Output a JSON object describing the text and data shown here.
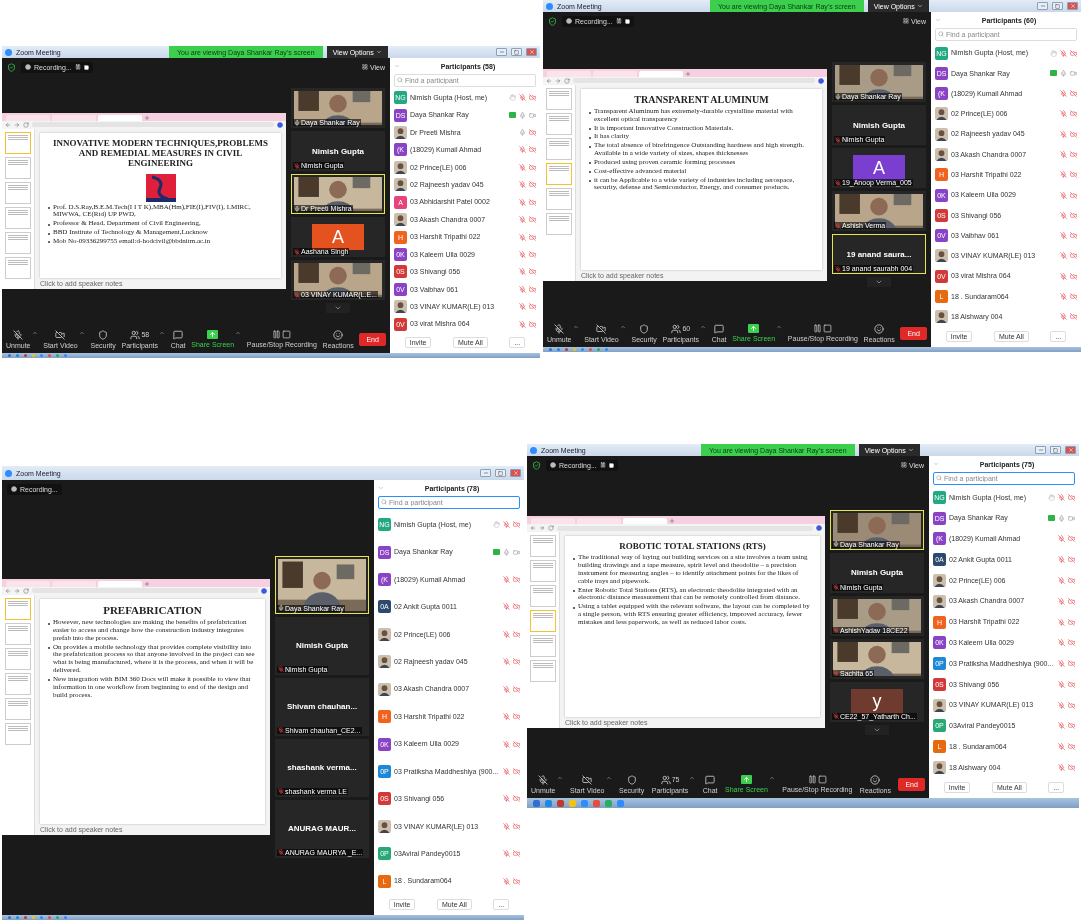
{
  "screenshots": [
    {
      "title": "Zoom Meeting",
      "banner": "You are viewing Daya Shankar Ray's screen",
      "view_options": "View Options",
      "secure": true,
      "recording": "Recording...",
      "recording_controls": true,
      "view": "View",
      "taskbar": true,
      "browser_tabs": [
        {
          "selected": false
        },
        {
          "selected": false
        },
        {
          "selected": true
        }
      ],
      "slide": {
        "title": "INNOVATIVE MODERN TECHNIQUES,PROBLEMS AND REMEDIAL MEASURES IN CIVIL ENGINEERING",
        "has_logo": true,
        "bullets": [
          "Prof. D.S.Ray,B.E.M.Tech(I I T K),MBA(Hm),FIE(I),FIV(I), LMIRC, MIWWA, CE(Rtd) UP PWD,",
          "Professor & Head, Department of Civil Engineering,",
          "BBD Institute of Technology & Management,Lucknow",
          "Mob No-09336299755    email:d-hodcivil@bbdnitm.ac.in"
        ],
        "notes": "Click to add speaker notes",
        "thumbnails": [
          {
            "selected": true
          },
          {
            "selected": false
          },
          {
            "selected": false
          },
          {
            "selected": false
          },
          {
            "selected": false
          },
          {
            "selected": false
          }
        ]
      },
      "videos": [
        {
          "kind": "video",
          "label": "Daya Shankar Ray",
          "mic_muted": false,
          "selected": false
        },
        {
          "kind": "name",
          "name": "Nimish Gupta",
          "label": "Nimish Gupta",
          "mic_muted": true,
          "selected": false
        },
        {
          "kind": "video",
          "label": "Dr Preeti Mishra",
          "mic_muted": false,
          "selected": true
        },
        {
          "kind": "avatar",
          "letter": "A",
          "color": "#e4531f",
          "label": "Aashana Singh",
          "mic_muted": true,
          "selected": false
        },
        {
          "kind": "video",
          "label": "03 VINAY KUMAR(L.E...",
          "mic_muted": true,
          "selected": false
        }
      ],
      "more_videos": true,
      "toolbar": [
        {
          "kind": "mic",
          "label": "Unmute",
          "menu": true
        },
        {
          "kind": "video",
          "label": "Start Video",
          "menu": true
        },
        {
          "kind": "security",
          "label": "Security",
          "menu": false
        },
        {
          "kind": "participants",
          "label": "Participants",
          "count": "58",
          "menu": true
        },
        {
          "kind": "chat",
          "label": "Chat",
          "menu": false
        },
        {
          "kind": "share",
          "label": "Share Screen",
          "menu": true
        },
        {
          "kind": "record",
          "label": "Pause/Stop Recording",
          "menu": false
        },
        {
          "kind": "reactions",
          "label": "Reactions",
          "menu": false
        }
      ],
      "end_button": "End",
      "participants": {
        "title": "Participants (58)",
        "search": {
          "placeholder": "Find a participant",
          "focused": false
        },
        "footer": [
          "Invite",
          "Mute All",
          "..."
        ],
        "rows": [
          {
            "kind": "initials",
            "initials": "NG",
            "color": "#22a882",
            "name": "Nimish Gupta (Host, me)",
            "host": true,
            "sharing": false,
            "mic_muted": true,
            "video_off": true
          },
          {
            "kind": "initials",
            "initials": "DS",
            "color": "#8a43c4",
            "name": "Daya Shankar Ray",
            "host": false,
            "sharing": true,
            "mic_muted": false,
            "video_off": false
          },
          {
            "name": "Dr Preeti Mishra",
            "host": false,
            "sharing": false,
            "mic_muted": false,
            "video_off": true
          },
          {
            "kind": "initials",
            "initials": "(K",
            "color": "#8a43c4",
            "name": "(18029) Kumail Ahmad",
            "host": false,
            "sharing": false,
            "mic_muted": true,
            "video_off": true
          },
          {
            "name": "02 Prince(LE) 006",
            "host": false,
            "sharing": false,
            "mic_muted": true,
            "video_off": true
          },
          {
            "name": "02 Rajneesh yadav 045",
            "host": false,
            "sharing": false,
            "mic_muted": true,
            "video_off": true
          },
          {
            "kind": "initials",
            "initials": "A",
            "color": "#e5457c",
            "name": "03 Abhidarshit Patel 0002",
            "host": false,
            "sharing": false,
            "mic_muted": true,
            "video_off": true
          },
          {
            "name": "03 Akash Chandra 0007",
            "host": false,
            "sharing": false,
            "mic_muted": true,
            "video_off": true
          },
          {
            "kind": "initials",
            "initials": "H",
            "color": "#f2621f",
            "name": "03 Harshit Tripathi 022",
            "host": false,
            "sharing": false,
            "mic_muted": true,
            "video_off": true
          },
          {
            "kind": "initials",
            "initials": "0K",
            "color": "#8a43c4",
            "name": "03 Kaleem Ulla 0029",
            "host": false,
            "sharing": false,
            "mic_muted": true,
            "video_off": true
          },
          {
            "kind": "initials",
            "initials": "0S",
            "color": "#d23a3a",
            "name": "03 Shivangi 056",
            "host": false,
            "sharing": false,
            "mic_muted": true,
            "video_off": true
          },
          {
            "kind": "initials",
            "initials": "0V",
            "color": "#8a43c4",
            "name": "03 Vaibhav 061",
            "host": false,
            "sharing": false,
            "mic_muted": true,
            "video_off": true
          },
          {
            "name": "03 VINAY KUMAR(LE) 013",
            "host": false,
            "sharing": false,
            "mic_muted": true,
            "video_off": true
          },
          {
            "kind": "initials",
            "initials": "0V",
            "color": "#d23a3a",
            "name": "03 virat Mishra 064",
            "host": false,
            "sharing": false,
            "mic_muted": true,
            "video_off": true
          }
        ]
      }
    },
    {
      "title": "Zoom Meeting",
      "banner": "You are viewing Daya Shankar Ray's screen",
      "view_options": "View Options",
      "secure": true,
      "recording": "Recording...",
      "recording_controls": true,
      "view": "View",
      "taskbar": true,
      "browser_tabs": [
        {
          "selected": false
        },
        {
          "selected": false
        },
        {
          "selected": true
        }
      ],
      "slide": {
        "title": "TRANSPARENT ALUMINUM",
        "has_logo": false,
        "bullets": [
          "Transparent Aluminum has extremely-durable crystalline material with excellent optical transparency",
          "It is important Innovative Construction Materials.",
          "It has clarity",
          "The total absence of birefringence Outstanding hardness and high strength. Available in a wide variety of sizes, shapes thicknesses",
          "Produced using proven ceramic forming processes",
          "Cost-effective advanced material",
          "it can be Applicable to a wide variety of industries including aerospace,  security, defense and Semiconductor, Energy, and consumer products."
        ],
        "notes": "Click to add speaker notes",
        "thumbnails": [
          {
            "selected": false
          },
          {
            "selected": false
          },
          {
            "selected": false
          },
          {
            "selected": true
          },
          {
            "selected": false
          },
          {
            "selected": false
          }
        ]
      },
      "videos": [
        {
          "kind": "video",
          "label": "Daya Shankar Ray",
          "mic_muted": false,
          "selected": false
        },
        {
          "kind": "name",
          "name": "Nimish Gupta",
          "label": "Nimish Gupta",
          "mic_muted": true,
          "selected": false
        },
        {
          "kind": "avatar",
          "letter": "A",
          "color": "#7b3fd0",
          "label": "19_Anoop Verma_005",
          "mic_muted": true,
          "selected": false
        },
        {
          "kind": "video",
          "label": "Ashish Verma",
          "mic_muted": true,
          "selected": false
        },
        {
          "kind": "name",
          "name": "19 anand saura...",
          "label": "19 anand saurabh 004",
          "mic_muted": true,
          "selected": true
        }
      ],
      "more_videos": true,
      "toolbar": [
        {
          "kind": "mic",
          "label": "Unmute",
          "menu": true
        },
        {
          "kind": "video",
          "label": "Start Video",
          "menu": true
        },
        {
          "kind": "security",
          "label": "Security",
          "menu": false
        },
        {
          "kind": "participants",
          "label": "Participants",
          "count": "60",
          "menu": true
        },
        {
          "kind": "chat",
          "label": "Chat",
          "menu": false
        },
        {
          "kind": "share",
          "label": "Share Screen",
          "menu": true
        },
        {
          "kind": "record",
          "label": "Pause/Stop Recording",
          "menu": false
        },
        {
          "kind": "reactions",
          "label": "Reactions",
          "menu": false
        }
      ],
      "end_button": "End",
      "participants": {
        "title": "Participants (60)",
        "search": {
          "placeholder": "Find a participant",
          "focused": false
        },
        "footer": [
          "Invite",
          "Mute All",
          "..."
        ],
        "rows": [
          {
            "kind": "initials",
            "initials": "NG",
            "color": "#22a882",
            "name": "Nimish Gupta (Host, me)",
            "host": true,
            "sharing": false,
            "mic_muted": true,
            "video_off": true
          },
          {
            "kind": "initials",
            "initials": "DS",
            "color": "#8a43c4",
            "name": "Daya Shankar Ray",
            "host": false,
            "sharing": true,
            "mic_muted": false,
            "video_off": false
          },
          {
            "kind": "initials",
            "initials": "(K",
            "color": "#8a43c4",
            "name": "(18029) Kumail Ahmad",
            "host": false,
            "sharing": false,
            "mic_muted": true,
            "video_off": true
          },
          {
            "name": "02 Prince(LE) 006",
            "host": false,
            "sharing": false,
            "mic_muted": true,
            "video_off": true
          },
          {
            "name": "02 Rajneesh yadav 045",
            "host": false,
            "sharing": false,
            "mic_muted": true,
            "video_off": true
          },
          {
            "name": "03 Akash Chandra 0007",
            "host": false,
            "sharing": false,
            "mic_muted": true,
            "video_off": true
          },
          {
            "kind": "initials",
            "initials": "H",
            "color": "#f2621f",
            "name": "03 Harshit Tripathi 022",
            "host": false,
            "sharing": false,
            "mic_muted": true,
            "video_off": true
          },
          {
            "kind": "initials",
            "initials": "0K",
            "color": "#8a43c4",
            "name": "03 Kaleem Ulla 0029",
            "host": false,
            "sharing": false,
            "mic_muted": true,
            "video_off": true
          },
          {
            "kind": "initials",
            "initials": "0S",
            "color": "#d23a3a",
            "name": "03 Shivangi 056",
            "host": false,
            "sharing": false,
            "mic_muted": true,
            "video_off": true
          },
          {
            "kind": "initials",
            "initials": "0V",
            "color": "#8a43c4",
            "name": "03 Vaibhav 061",
            "host": false,
            "sharing": false,
            "mic_muted": true,
            "video_off": true
          },
          {
            "name": "03 VINAY KUMAR(LE) 013",
            "host": false,
            "sharing": false,
            "mic_muted": true,
            "video_off": true
          },
          {
            "kind": "initials",
            "initials": "0V",
            "color": "#d23a3a",
            "name": "03 virat Mishra 064",
            "host": false,
            "sharing": false,
            "mic_muted": true,
            "video_off": true
          },
          {
            "kind": "initials",
            "initials": "L",
            "color": "#e86a10",
            "name": "18 . Sundaram064",
            "host": false,
            "sharing": false,
            "mic_muted": true,
            "video_off": true
          },
          {
            "name": "18 Aishwary 004",
            "host": false,
            "sharing": false,
            "mic_muted": true,
            "video_off": true
          }
        ]
      }
    },
    {
      "title": "Zoom Meeting",
      "secure": false,
      "recording": "Recording...",
      "recording_controls": false,
      "taskbar": true,
      "browser_tabs": [
        {
          "selected": false
        },
        {
          "selected": false
        },
        {
          "selected": true
        }
      ],
      "slide": {
        "title": "PREFABRICATION",
        "has_logo": false,
        "bullets": [
          "However, new technologies are making the benefits of prefabrication easier to access and change how the construction industry integrates prefab into the process.",
          "On provides a mobile technology that provides complete visibility into the prefabrication process so that anyone involved in the project can see what is being manufactured, where it is the process, and when it will be delivered.",
          "New integration with BIM 360 Docs will make it possible to view that information in one workflow from beginning to end of the design and build process."
        ],
        "notes": "Click to add speaker notes",
        "thumbnails": [
          {
            "selected": true
          },
          {
            "selected": false
          },
          {
            "selected": false
          },
          {
            "selected": false
          },
          {
            "selected": false
          },
          {
            "selected": false
          }
        ]
      },
      "videos": [
        {
          "kind": "video",
          "label": "Daya Shankar Ray",
          "mic_muted": false,
          "selected": true
        },
        {
          "kind": "name",
          "name": "Nimish Gupta",
          "label": "Nimish Gupta",
          "mic_muted": true,
          "selected": false
        },
        {
          "kind": "name",
          "name": "Shivam  chauhan...",
          "label": "Shivam chauhan_CE2...",
          "mic_muted": true,
          "selected": false
        },
        {
          "kind": "name",
          "name": "shashank  verma...",
          "label": "shashank verma LE",
          "mic_muted": true,
          "selected": false
        },
        {
          "kind": "name",
          "name": "ANURAG MAUR...",
          "label": "ANURAG MAURYA _E...",
          "mic_muted": true,
          "selected": false
        }
      ],
      "more_videos": false,
      "participants": {
        "title": "Participants (78)",
        "search": {
          "placeholder": "Find a participant",
          "focused": true
        },
        "footer": [
          "Invite",
          "Mute All",
          "..."
        ],
        "rows": [
          {
            "kind": "initials",
            "initials": "NG",
            "color": "#22a882",
            "name": "Nimish Gupta (Host, me)",
            "host": true,
            "sharing": false,
            "mic_muted": true,
            "video_off": true
          },
          {
            "kind": "initials",
            "initials": "DS",
            "color": "#8a43c4",
            "name": "Daya Shankar Ray",
            "host": false,
            "sharing": true,
            "mic_muted": false,
            "video_off": false
          },
          {
            "kind": "initials",
            "initials": "(K",
            "color": "#8a43c4",
            "name": "(18029) Kumail Ahmad",
            "host": false,
            "sharing": false,
            "mic_muted": true,
            "video_off": true
          },
          {
            "kind": "initials",
            "initials": "0A",
            "color": "#2c4a6e",
            "name": "02 Ankit Gupta 0011",
            "host": false,
            "sharing": false,
            "mic_muted": true,
            "video_off": true
          },
          {
            "name": "02 Prince(LE) 006",
            "host": false,
            "sharing": false,
            "mic_muted": true,
            "video_off": true
          },
          {
            "name": "02 Rajneesh yadav 045",
            "host": false,
            "sharing": false,
            "mic_muted": true,
            "video_off": true
          },
          {
            "name": "03 Akash Chandra 0007",
            "host": false,
            "sharing": false,
            "mic_muted": true,
            "video_off": true
          },
          {
            "kind": "initials",
            "initials": "H",
            "color": "#f2621f",
            "name": "03 Harshit Tripathi 022",
            "host": false,
            "sharing": false,
            "mic_muted": true,
            "video_off": true
          },
          {
            "kind": "initials",
            "initials": "0K",
            "color": "#8a43c4",
            "name": "03 Kaleem Ulla 0029",
            "host": false,
            "sharing": false,
            "mic_muted": true,
            "video_off": true
          },
          {
            "kind": "initials",
            "initials": "0P",
            "color": "#1e88d6",
            "name": "03 Pratiksha Maddheshiya (900...",
            "host": false,
            "sharing": false,
            "mic_muted": true,
            "video_off": true
          },
          {
            "kind": "initials",
            "initials": "0S",
            "color": "#d23a3a",
            "name": "03 Shivangi 056",
            "host": false,
            "sharing": false,
            "mic_muted": true,
            "video_off": true
          },
          {
            "name": "03 VINAY KUMAR(LE) 013",
            "host": false,
            "sharing": false,
            "mic_muted": true,
            "video_off": true
          },
          {
            "kind": "initials",
            "initials": "0P",
            "color": "#27a874",
            "name": "03Aviral Pandey0015",
            "host": false,
            "sharing": false,
            "mic_muted": true,
            "video_off": true
          },
          {
            "kind": "initials",
            "initials": "L",
            "color": "#e86a10",
            "name": "18 . Sundaram064",
            "host": false,
            "sharing": false,
            "mic_muted": true,
            "video_off": true
          }
        ]
      }
    },
    {
      "title": "Zoom Meeting",
      "banner": "You are viewing Daya Shankar Ray's screen",
      "view_options": "View Options",
      "secure": true,
      "recording": "Recording...",
      "recording_controls": true,
      "view": "View",
      "taskbar": true,
      "browser_tabs": [
        {
          "selected": false
        },
        {
          "selected": false
        },
        {
          "selected": true
        }
      ],
      "slide": {
        "title": "ROBOTIC TOTAL STATIONS (RTS)",
        "has_logo": false,
        "bullets": [
          "The traditional way of laying out building services on a site involves a team using building drawings and a tape measure, spirit level and theodolite – a precision instrument for measuring angles – to identify attachment points for the likes of cable trays and pipework.",
          "Enter Robotic Total Stations (RTS), an electronic theodolite integrated with an electronic distance measurement that can be remotely controlled from distance.",
          "Using a tablet equipped with the relevant software, the layout can be completed by a single person, with RTS ensuring greater efficiency, improved accuracy, fewer mistakes and less paperwork, as well as reduced labor costs."
        ],
        "notes": "Click to add speaker notes",
        "thumbnails": [
          {
            "selected": false
          },
          {
            "selected": false
          },
          {
            "selected": false
          },
          {
            "selected": true
          },
          {
            "selected": false
          },
          {
            "selected": false
          }
        ]
      },
      "videos": [
        {
          "kind": "video",
          "label": "Daya Shankar Ray",
          "mic_muted": false,
          "selected": true
        },
        {
          "kind": "name",
          "name": "Nimish Gupta",
          "label": "Nimish Gupta",
          "mic_muted": true,
          "selected": false
        },
        {
          "kind": "video",
          "label": "AshishYadav 18CE22",
          "mic_muted": true,
          "selected": false
        },
        {
          "kind": "video",
          "label": "Sachita 65",
          "mic_muted": true,
          "selected": false
        },
        {
          "kind": "avatar",
          "letter": "y",
          "color": "#6e3b2e",
          "label": "CE22_57_Yatharth Ch...",
          "mic_muted": true,
          "selected": false
        }
      ],
      "more_videos": true,
      "toolbar": [
        {
          "kind": "mic",
          "label": "Unmute",
          "menu": true
        },
        {
          "kind": "video",
          "label": "Start Video",
          "menu": true
        },
        {
          "kind": "security",
          "label": "Security",
          "menu": false
        },
        {
          "kind": "participants",
          "label": "Participants",
          "count": "75",
          "menu": true
        },
        {
          "kind": "chat",
          "label": "Chat",
          "menu": false
        },
        {
          "kind": "share",
          "label": "Share Screen",
          "menu": true
        },
        {
          "kind": "record",
          "label": "Pause/Stop Recording",
          "menu": false
        },
        {
          "kind": "reactions",
          "label": "Reactions",
          "menu": false
        }
      ],
      "end_button": "End",
      "participants": {
        "title": "Participants (75)",
        "search": {
          "placeholder": "Find a participant",
          "focused": true
        },
        "footer": [
          "Invite",
          "Mute All",
          "..."
        ],
        "rows": [
          {
            "kind": "initials",
            "initials": "NG",
            "color": "#22a882",
            "name": "Nimish Gupta (Host, me)",
            "host": true,
            "sharing": false,
            "mic_muted": true,
            "video_off": true
          },
          {
            "kind": "initials",
            "initials": "DS",
            "color": "#8a43c4",
            "name": "Daya Shankar Ray",
            "host": false,
            "sharing": true,
            "mic_muted": false,
            "video_off": false
          },
          {
            "kind": "initials",
            "initials": "(K",
            "color": "#8a43c4",
            "name": "(18029) Kumail Ahmad",
            "host": false,
            "sharing": false,
            "mic_muted": true,
            "video_off": true
          },
          {
            "kind": "initials",
            "initials": "0A",
            "color": "#2c4a6e",
            "name": "02 Ankit Gupta 0011",
            "host": false,
            "sharing": false,
            "mic_muted": true,
            "video_off": true
          },
          {
            "name": "02 Prince(LE) 006",
            "host": false,
            "sharing": false,
            "mic_muted": true,
            "video_off": true
          },
          {
            "name": "03 Akash Chandra 0007",
            "host": false,
            "sharing": false,
            "mic_muted": true,
            "video_off": true
          },
          {
            "kind": "initials",
            "initials": "H",
            "color": "#f2621f",
            "name": "03 Harshit Tripathi 022",
            "host": false,
            "sharing": false,
            "mic_muted": true,
            "video_off": true
          },
          {
            "kind": "initials",
            "initials": "0K",
            "color": "#8a43c4",
            "name": "03 Kaleem Ulla 0029",
            "host": false,
            "sharing": false,
            "mic_muted": true,
            "video_off": true
          },
          {
            "kind": "initials",
            "initials": "0P",
            "color": "#1e88d6",
            "name": "03 Pratiksha Maddheshiya (900...",
            "host": false,
            "sharing": false,
            "mic_muted": true,
            "video_off": true
          },
          {
            "kind": "initials",
            "initials": "0S",
            "color": "#d23a3a",
            "name": "03 Shivangi 056",
            "host": false,
            "sharing": false,
            "mic_muted": true,
            "video_off": true
          },
          {
            "name": "03 VINAY KUMAR(LE) 013",
            "host": false,
            "sharing": false,
            "mic_muted": true,
            "video_off": true
          },
          {
            "kind": "initials",
            "initials": "0P",
            "color": "#27a874",
            "name": "03Aviral Pandey0015",
            "host": false,
            "sharing": false,
            "mic_muted": true,
            "video_off": true
          },
          {
            "kind": "initials",
            "initials": "L",
            "color": "#e86a10",
            "name": "18 . Sundaram064",
            "host": false,
            "sharing": false,
            "mic_muted": true,
            "video_off": true
          },
          {
            "name": "18 Aishwary 004",
            "host": false,
            "sharing": false,
            "mic_muted": true,
            "video_off": true
          }
        ]
      }
    }
  ]
}
